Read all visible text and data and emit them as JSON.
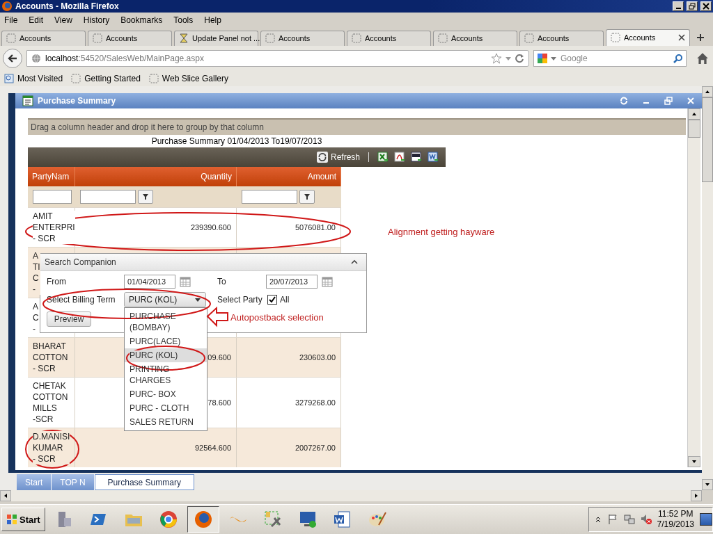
{
  "window": {
    "title": "Accounts - Mozilla Firefox"
  },
  "menu": [
    "File",
    "Edit",
    "View",
    "History",
    "Bookmarks",
    "Tools",
    "Help"
  ],
  "tabs": [
    {
      "label": "Accounts",
      "selected": false,
      "kind": "page"
    },
    {
      "label": "Accounts",
      "selected": false,
      "kind": "page"
    },
    {
      "label": "Update Panel not ...",
      "selected": false,
      "kind": "loading"
    },
    {
      "label": "Accounts",
      "selected": false,
      "kind": "page"
    },
    {
      "label": "Accounts",
      "selected": false,
      "kind": "page"
    },
    {
      "label": "Accounts",
      "selected": false,
      "kind": "page"
    },
    {
      "label": "Accounts",
      "selected": false,
      "kind": "page"
    },
    {
      "label": "Accounts",
      "selected": true,
      "kind": "page"
    }
  ],
  "address_bar": {
    "host": "localhost",
    "path": ":54520/SalesWeb/MainPage.aspx"
  },
  "search": {
    "placeholder": "Google"
  },
  "bookmarks": [
    "Most Visited",
    "Getting Started",
    "Web Slice Gallery"
  ],
  "panel": {
    "title": "Purchase Summary",
    "group_hint": "Drag a column header and drop it here to group by that column",
    "caption": "Purchase Summary 01/04/2013 To19/07/2013",
    "refresh": "Refresh",
    "columns": [
      "PartyNam",
      "Quantity",
      "Amount"
    ],
    "rows": [
      {
        "party": [
          "AMIT",
          "ENTERPRI",
          "- SCR"
        ],
        "quantity": "239390.600",
        "amount": "5076081.00"
      },
      {
        "party": [
          "A",
          "TI",
          "C",
          "-"
        ]
      },
      {
        "party": [
          "A",
          "C",
          "-"
        ]
      },
      {
        "party": [
          "BHARAT",
          "COTTON",
          "- SCR"
        ],
        "quantity": "09.600",
        "amount": "230603.00"
      },
      {
        "party": [
          "CHETAK",
          "COTTON",
          "MILLS",
          "-SCR"
        ],
        "quantity": "78.600",
        "amount": "3279268.00"
      },
      {
        "party": [
          "D.MANISI",
          "KUMAR",
          "- SCR"
        ],
        "quantity": "92564.600",
        "amount": "2007267.00"
      }
    ]
  },
  "search_companion": {
    "title": "Search Companion",
    "from_label": "From",
    "from_value": "01/04/2013",
    "to_label": "To",
    "to_value": "20/07/2013",
    "billing_label": "Select Billing Term",
    "billing_value": "PURC (KOL)",
    "party_label": "Select Party",
    "all_checked": true,
    "all_label": "All",
    "preview": "Preview",
    "options": [
      {
        "label": "PURCHASE (BOMBAY)",
        "selected": false
      },
      {
        "label": "PURC(LACE)",
        "selected": false
      },
      {
        "label": "PURC (KOL)",
        "selected": true
      },
      {
        "label": "PRINTING CHARGES",
        "selected": false
      },
      {
        "label": "PURC- BOX",
        "selected": false
      },
      {
        "label": "PURC - CLOTH",
        "selected": false
      },
      {
        "label": "SALES RETURN",
        "selected": false
      }
    ]
  },
  "annotations": [
    "Alignment getting hayware",
    "Autopostback selection"
  ],
  "bottom_tabs": [
    {
      "label": "Start",
      "selected": false
    },
    {
      "label": "TOP N",
      "selected": false
    },
    {
      "label": "Purchase Summary",
      "selected": true
    }
  ],
  "taskbar": {
    "start": "Start",
    "time": "11:52 PM",
    "date": "7/19/2013"
  }
}
